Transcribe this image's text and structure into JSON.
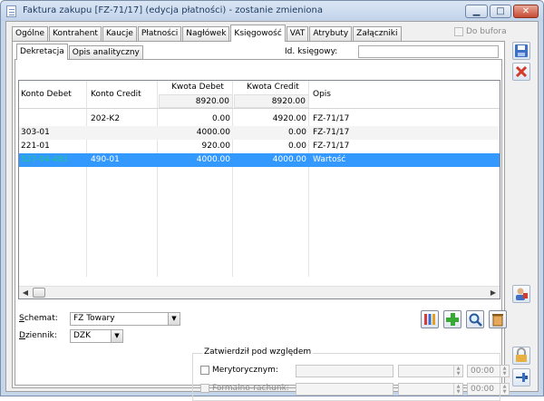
{
  "window": {
    "title": "Faktura zakupu [FZ-71/17] (edycja płatności) - zostanie zmieniona",
    "min_glyph": "▁",
    "max_glyph": "□",
    "close_glyph": "✕"
  },
  "tabs": [
    {
      "label": "Ogólne"
    },
    {
      "label": "Kontrahent"
    },
    {
      "label": "Kaucje"
    },
    {
      "label": "Płatności"
    },
    {
      "label": "Nagłówek"
    },
    {
      "label": "Księgowość",
      "active": true
    },
    {
      "label": "VAT"
    },
    {
      "label": "Atrybuty"
    },
    {
      "label": "Załączniki"
    }
  ],
  "do_bufora": {
    "label": "Do bufora",
    "checked": false
  },
  "subtabs": [
    {
      "label": "Dekretacja",
      "active": true
    },
    {
      "label": "Opis analityczny"
    }
  ],
  "id_ksiegowy": {
    "label": "Id. księgowy:",
    "value": ""
  },
  "grid": {
    "headers": {
      "konto_debet": "Konto Debet",
      "konto_credit": "Konto Credit",
      "kwota_debet": "Kwota Debet",
      "kwota_credit": "Kwota Credit",
      "opis": "Opis"
    },
    "sums": {
      "kwota_debet": "8920.00",
      "kwota_credit": "8920.00"
    },
    "rows": [
      {
        "konto_debet": "",
        "konto_credit": "202-K2",
        "kwota_debet": "0.00",
        "kwota_credit": "4920.00",
        "opis": "FZ-71/17"
      },
      {
        "konto_debet": "303-01",
        "konto_credit": "",
        "kwota_debet": "4000.00",
        "kwota_credit": "0.00",
        "opis": "FZ-71/17"
      },
      {
        "konto_debet": "221-01",
        "konto_credit": "",
        "kwota_debet": "920.00",
        "kwota_credit": "0.00",
        "opis": "FZ-71/17"
      },
      {
        "konto_debet": "527-04-481",
        "konto_credit": "490-01",
        "kwota_debet": "4000.00",
        "kwota_credit": "4000.00",
        "opis": "Wartość",
        "selected": true
      }
    ],
    "selected_debet_color": "#21c58f",
    "selected_row_color": "#3399ff"
  },
  "schemat": {
    "label": "Schemat:",
    "value": "FZ Towary"
  },
  "dziennik": {
    "label": "Dziennik:",
    "value": "DZK"
  },
  "zatwierdzil": {
    "legend": "Zatwierdził pod względem",
    "merytorycznym": {
      "label": "Merytorycznym:",
      "time": "00:00"
    },
    "formalno": {
      "label": "Formalno-rachunk:",
      "time": "00:00"
    }
  },
  "toolbar_icons": [
    "columns-icon",
    "add-icon",
    "search-icon",
    "delete-icon"
  ],
  "colors": {
    "accent": "#3399ff",
    "titlebar": "#c5d5ea"
  }
}
